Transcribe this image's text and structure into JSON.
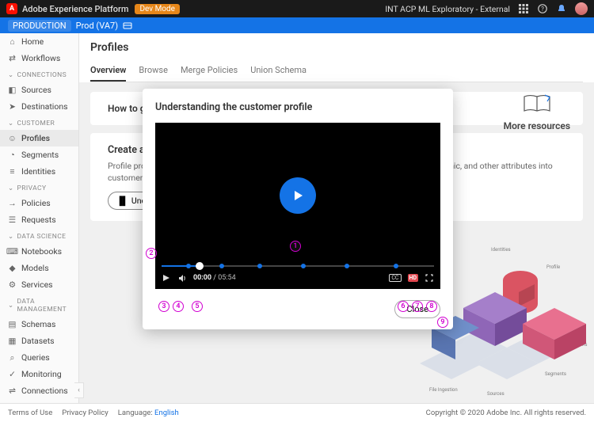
{
  "topbar": {
    "app_name": "Adobe Experience Platform",
    "mode_tag": "Dev Mode",
    "org_name": "INT ACP ML Exploratory - External"
  },
  "envbar": {
    "env_label": "PRODUCTION",
    "env_value": "Prod (VA7)"
  },
  "sidebar": {
    "home": "Home",
    "workflows": "Workflows",
    "group_connections": "CONNECTIONS",
    "sources": "Sources",
    "destinations": "Destinations",
    "group_customer": "CUSTOMER",
    "profiles": "Profiles",
    "segments": "Segments",
    "identities": "Identities",
    "group_privacy": "PRIVACY",
    "policies": "Policies",
    "requests": "Requests",
    "group_datascience": "DATA SCIENCE",
    "notebooks": "Notebooks",
    "models": "Models",
    "services": "Services",
    "group_datamgmt": "DATA MANAGEMENT",
    "schemas": "Schemas",
    "datasets": "Datasets",
    "queries": "Queries",
    "monitoring": "Monitoring",
    "connections_item": "Connections"
  },
  "page": {
    "title": "Profiles",
    "tabs": {
      "overview": "Overview",
      "browse": "Browse",
      "merge": "Merge Policies",
      "union": "Union Schema"
    },
    "howto": "How to get my data into Real-time Customer Profile",
    "card": {
      "title": "Create a Real-time Customer Profile for customer insights",
      "body": "Profile provides a single view of the customer by combining behavioral, attitudinal, demographic, and other attributes into customer profiles.",
      "btn": "Understanding the customer profile"
    },
    "resources": "More resources",
    "iso_labels": {
      "identities": "Identities",
      "profile": "Profile",
      "destinations": "Destinations",
      "segments": "Segments",
      "sources": "Sources",
      "fileingestion": "File Ingestion"
    }
  },
  "modal": {
    "title": "Understanding the customer profile",
    "current_time": "00:00",
    "duration": "05:54",
    "hd": "HD",
    "cc": "CC",
    "close": "Close",
    "chapter_positions_pct": [
      10,
      22,
      36,
      52,
      68,
      86
    ]
  },
  "footer": {
    "terms": "Terms of Use",
    "privacy": "Privacy Policy",
    "language_label": "Language:",
    "language_value": "English",
    "copyright": "Copyright © 2020 Adobe Inc. All rights reserved."
  },
  "callouts": [
    "1",
    "2",
    "3",
    "4",
    "5",
    "6",
    "7",
    "8",
    "9"
  ]
}
